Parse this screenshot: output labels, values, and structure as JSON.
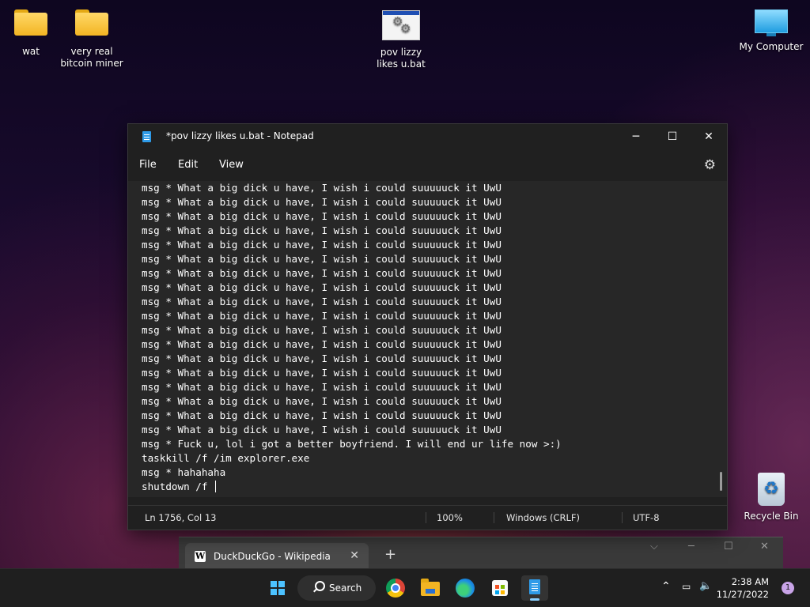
{
  "desktop": {
    "icons": [
      {
        "label": "wat"
      },
      {
        "label": "very real bitcoin miner"
      },
      {
        "label": "pov lizzy likes u.bat"
      },
      {
        "label": "My Computer"
      },
      {
        "label": "Recycle Bin"
      }
    ]
  },
  "notepad": {
    "title": "*pov lizzy likes u.bat - Notepad",
    "controls": {
      "minimize": "─",
      "maximize": "☐",
      "close": "✕"
    },
    "menu": {
      "file": "File",
      "edit": "Edit",
      "view": "View"
    },
    "settings_icon": "⚙",
    "lines": [
      "msg * What a big dick u have, I wish i could suuuuuck it UwU",
      "msg * What a big dick u have, I wish i could suuuuuck it UwU",
      "msg * What a big dick u have, I wish i could suuuuuck it UwU",
      "msg * What a big dick u have, I wish i could suuuuuck it UwU",
      "msg * What a big dick u have, I wish i could suuuuuck it UwU",
      "msg * What a big dick u have, I wish i could suuuuuck it UwU",
      "msg * What a big dick u have, I wish i could suuuuuck it UwU",
      "msg * What a big dick u have, I wish i could suuuuuck it UwU",
      "msg * What a big dick u have, I wish i could suuuuuck it UwU",
      "msg * What a big dick u have, I wish i could suuuuuck it UwU",
      "msg * What a big dick u have, I wish i could suuuuuck it UwU",
      "msg * What a big dick u have, I wish i could suuuuuck it UwU",
      "msg * What a big dick u have, I wish i could suuuuuck it UwU",
      "msg * What a big dick u have, I wish i could suuuuuck it UwU",
      "msg * What a big dick u have, I wish i could suuuuuck it UwU",
      "msg * What a big dick u have, I wish i could suuuuuck it UwU",
      "msg * What a big dick u have, I wish i could suuuuuck it UwU",
      "msg * What a big dick u have, I wish i could suuuuuck it UwU",
      "msg * Fuck u, lol i got a better boyfriend. I will end ur life now >:)",
      "taskkill /f /im explorer.exe",
      "msg * hahahaha",
      "shutdown /f "
    ],
    "status": {
      "position": "Ln 1756, Col 13",
      "zoom": "100%",
      "line_ending": "Windows (CRLF)",
      "encoding": "UTF-8"
    }
  },
  "browser": {
    "tab_label": "DuckDuckGo - Wikipedia",
    "favicon": "W",
    "tab_close": "✕",
    "new_tab": "+",
    "controls": {
      "dropdown": "⌵",
      "minimize": "─",
      "maximize": "☐",
      "close": "✕"
    }
  },
  "taskbar": {
    "search_label": "Search",
    "tray": {
      "chevron": "⌃",
      "wifi": "▭",
      "volume": "🔈"
    },
    "time": "2:38 AM",
    "date": "11/27/2022",
    "notification_count": "1"
  }
}
